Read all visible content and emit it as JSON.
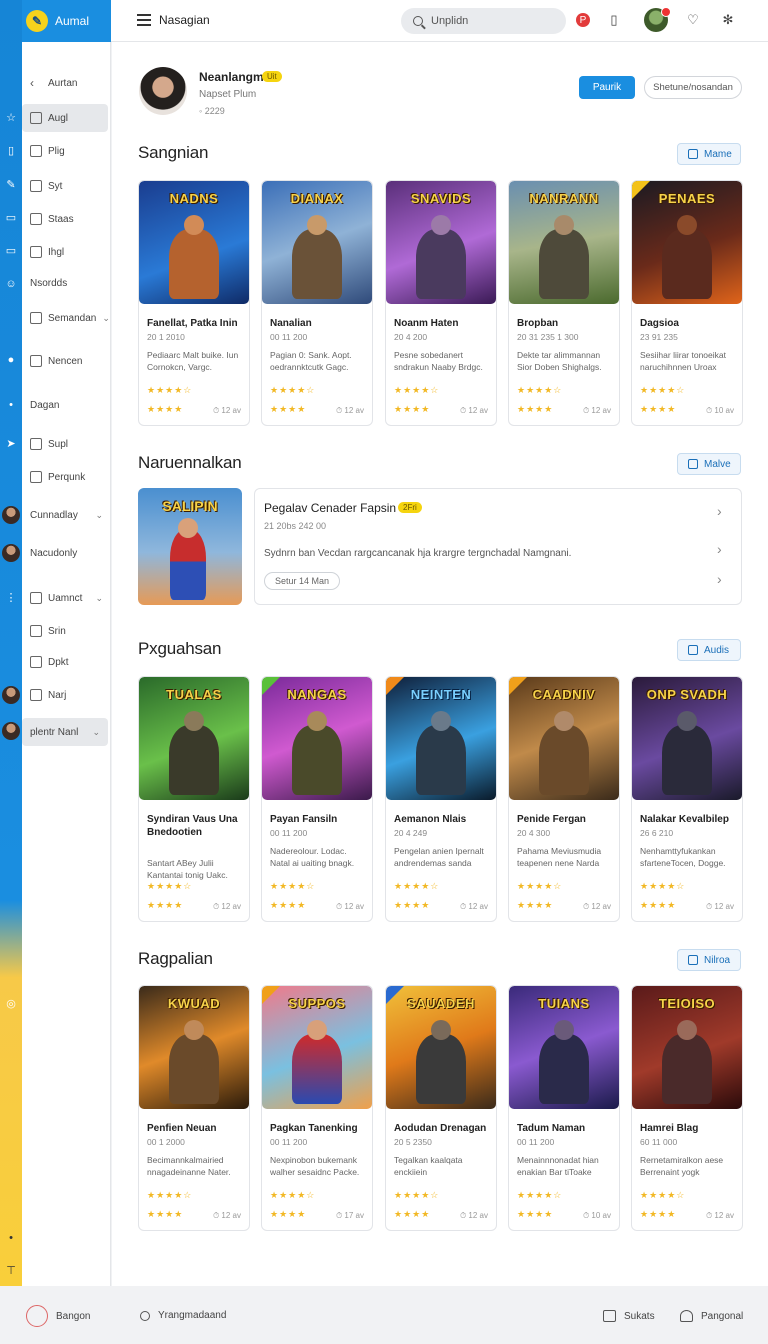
{
  "brand": {
    "name": "Aumal"
  },
  "topbar": {
    "title": "Nasagian",
    "search_placeholder": "Unplidn",
    "icons": [
      "hamburger-icon",
      "search-icon",
      "pin-icon",
      "bookmark-icon",
      "avatar",
      "chat-icon",
      "settings-icon"
    ]
  },
  "sidebar": {
    "items": [
      {
        "label": "Aurtan",
        "icon": "back-arrow-icon"
      },
      {
        "label": "Augl"
      },
      {
        "label": "Plig"
      },
      {
        "label": "Syt"
      },
      {
        "label": "Staas"
      },
      {
        "label": "Ihgl"
      },
      {
        "label": "Nsordds"
      },
      {
        "label": "Semandan",
        "chevron": true
      },
      {
        "label": "Nencen"
      },
      {
        "label": "Dagan"
      },
      {
        "label": "Supl"
      },
      {
        "label": "Perqunk"
      },
      {
        "label": "Cunnadlay",
        "chevron": true
      },
      {
        "label": "Nacudonly"
      },
      {
        "label": "Uamnct",
        "chevron": true
      },
      {
        "label": "Srin"
      },
      {
        "label": "Dpkt"
      },
      {
        "label": "Narj"
      },
      {
        "label": "plentr Nanl",
        "chevron": true
      }
    ]
  },
  "profile": {
    "name": "Neanlangm",
    "badge": "Uit",
    "subtitle": "Napset Plum",
    "meta": "2229",
    "primary_button": "Paurik",
    "secondary_button": "Shetune/nosandan"
  },
  "sections": [
    {
      "title": "Sangnian",
      "button": "Mame",
      "cards": [
        {
          "art_title": "NADNS",
          "title": "Fanellat, Patka Inin",
          "meta": "20 1 2010",
          "desc": "Pediaarc Malt buike. Iun Cornokcn, Vargc.",
          "stat": "12 av"
        },
        {
          "art_title": "DIANAX",
          "title": "Nanalian",
          "meta": "00 11 200",
          "desc": "Pagian 0: Sank. Aopt. oedrannktcutk Gagc.",
          "stat": "12 av"
        },
        {
          "art_title": "SNAVIDS",
          "title": "Noanm Haten",
          "meta": "20 4 200",
          "desc": "Pesne sobedanert sndrakun Naaby Brdgc.",
          "stat": "12 av"
        },
        {
          "art_title": "NANRANN",
          "title": "Bropban",
          "meta": "20 31 235 1 300",
          "desc": "Dekte tar alimmannan Sior Doben Shighalgs.",
          "stat": "12 av"
        },
        {
          "art_title": "PENAES",
          "title": "Dagsioa",
          "meta": "23 91 235",
          "desc": "Sesiihar liirar tonoeikat naruchihnnen Uroax",
          "stat": "10 av"
        }
      ]
    },
    {
      "title": "Naruennalkan",
      "button": "Malve",
      "featured": {
        "art_title": "SALIPIN",
        "title": "Pegalav Cenader Fapsin",
        "badge": "2Fri",
        "meta": "21 20bs 242 00",
        "desc": "Sydnrn ban Vecdan rargcancanak hja krargre tergnchadal Namgnani.",
        "pill": "Setur 14 Man"
      }
    },
    {
      "title": "Pxguahsan",
      "button": "Audis",
      "cards": [
        {
          "art_title": "TUALAS",
          "title": "Syndiran Vaus Una Bnedootien",
          "meta": "",
          "desc": "Santart ABey Julii Kantantai tonig Uakc.",
          "stat": "12 av"
        },
        {
          "art_title": "NANGAS",
          "title": "Payan Fansiln",
          "meta": "00 11 200",
          "desc": "Nadereolour. Lodac. Natal ai uaiting bnagk.",
          "stat": "12 av"
        },
        {
          "art_title": "NEINTEN",
          "title": "Aemanon Nlais",
          "meta": "20 4 249",
          "desc": "Pengelan anien Ipernalt andrendemas sanda",
          "stat": "12 av"
        },
        {
          "art_title": "CAADNIV",
          "title": "Penide Fergan",
          "meta": "20 4 300",
          "desc": "Pahama Meviusmudia teapenen nene Narda",
          "stat": "12 av"
        },
        {
          "art_title": "ONP SVADH",
          "title": "Nalakar Kevalbilep",
          "meta": "26 6 210",
          "desc": "Nenhamttyfukankan sfarteneTocen, Dogge.",
          "stat": "12 av"
        }
      ]
    },
    {
      "title": "Ragpalian",
      "button": "Nilroa",
      "cards": [
        {
          "art_title": "KWUAD",
          "title": "Penfien Neuan",
          "meta": "00 1 2000",
          "desc": "Becimannkalmairied nnagadeinanne Nater.",
          "stat": "12 av"
        },
        {
          "art_title": "SUPPOS",
          "title": "Pagkan Tanenking",
          "meta": "00 11 200",
          "desc": "Nexpinobon bukemank walher sesaidnc Packe.",
          "stat": "17 av"
        },
        {
          "art_title": "SAUADEH",
          "title": "Aodudan Drenagan",
          "meta": "20 5 2350",
          "desc": "Tegalkan kaalqata enckiiein",
          "stat": "12 av"
        },
        {
          "art_title": "TUIANS",
          "title": "Tadum Naman",
          "meta": "00 11 200",
          "desc": "Menainnnonadat hian enakian Bar tiToake",
          "stat": "10 av"
        },
        {
          "art_title": "TEIOISO",
          "title": "Hamrei Blag",
          "meta": "60 11 000",
          "desc": "Rernetamiralkon aese Berrenaint yogk",
          "stat": "12 av"
        }
      ]
    }
  ],
  "bottombar": {
    "left_label": "Bangon",
    "search_label": "Yrangmadaand",
    "stats_label": "Sukats",
    "profile_label": "Pangonal"
  },
  "colors": {
    "accent": "#1a8ee0",
    "badge": "#f5d40f",
    "star": "#f2b824"
  }
}
